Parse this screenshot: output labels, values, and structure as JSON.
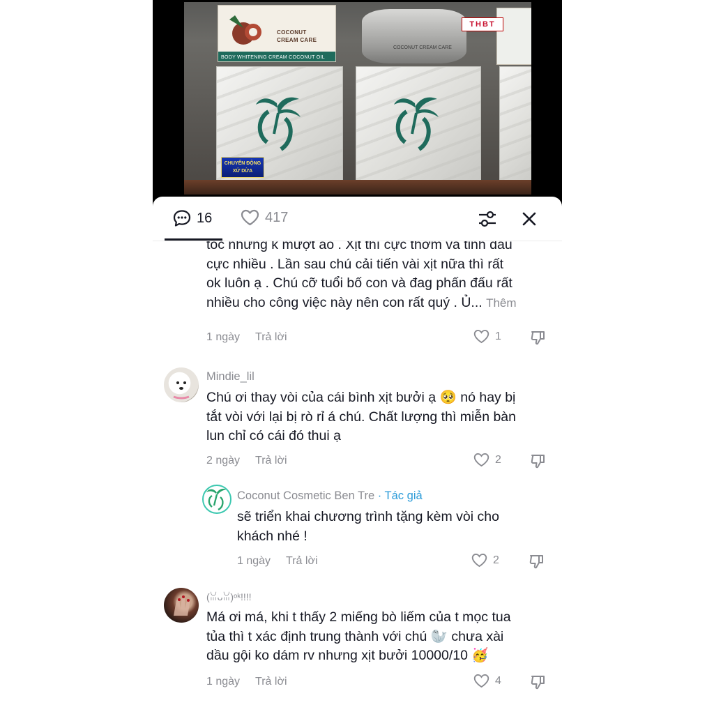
{
  "video": {
    "channel_logo": "THBT",
    "program_badge_line1": "CHUYỂN ĐỘNG",
    "program_badge_line2": "XỨ DỪA",
    "product1_line1": "COCONUT",
    "product1_line2": "CREAM CARE",
    "product1_band": "BODY WHITENING CREAM COCONUT OIL",
    "product2_text": "COCONUT CREAM CARE"
  },
  "header": {
    "comments_icon": "comment-bubble-icon",
    "comments_count": "16",
    "likes_icon": "heart-outline-icon",
    "likes_count": "417",
    "filter_icon": "sliders-icon",
    "close_icon": "close-icon"
  },
  "comments": [
    {
      "text_lines": [
        "tóc nhưng k mượt ảo . Xịt thì cực thơm và tinh dầu",
        "cực nhiều . Lần sau chú cải tiến vài xịt nữa thì rất",
        "ok luôn ạ . Chú cỡ tuổi bố con và đag phấn đấu rất",
        "nhiều cho công việc này nên con rất quý . Ủ..."
      ],
      "more": "Thêm",
      "time": "1 ngày",
      "reply": "Trả lời",
      "likes": "1"
    },
    {
      "username": "Mindie_lil",
      "text_lines": [
        "Chú ơi thay vòi của cái bình xịt bưởi ạ 🥺 nó hay bị",
        "tắt vòi với lại bị rò rỉ á chú. Chất lượng thì miễn bàn",
        "lun chỉ có cái đó thui ạ"
      ],
      "time": "2 ngày",
      "reply": "Trả lời",
      "likes": "2"
    },
    {
      "username": "Coconut Cosmetic Ben Tre",
      "author_tag": "· Tác giả",
      "text_lines": [
        "sẽ triển khai chương trình tặng kèm vòi cho",
        "khách nhé !"
      ],
      "time": "1 ngày",
      "reply": "Trả lời",
      "likes": "2"
    },
    {
      "username": "(ꈍᴗꈍ)ᵒᵏ!!!!",
      "text_lines": [
        "Má ơi má, khi t thấy 2 miếng bò liếm của t mọc tua",
        "tủa thì t xác định trung thành với chú 🦭  chưa xài",
        "dầu gội ko dám rv nhưng xịt bưởi 10000/10 🥳"
      ],
      "time": "1 ngày",
      "reply": "Trả lời",
      "likes": "4"
    }
  ],
  "colors": {
    "accent_author": "#2b9bd8",
    "muted": "#8a8b91",
    "text": "#161823"
  }
}
